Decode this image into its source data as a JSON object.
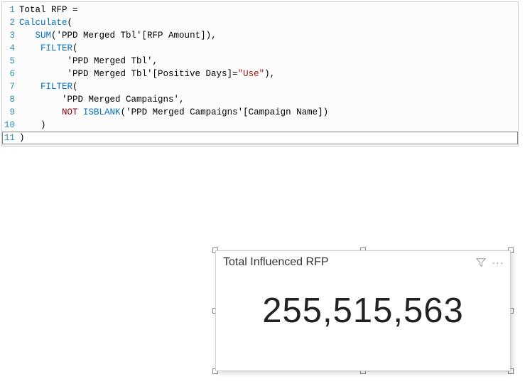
{
  "formula": {
    "lines": [
      {
        "num": "1",
        "indent": "",
        "tokens": [
          {
            "t": "plain",
            "v": "Total RFP = "
          }
        ]
      },
      {
        "num": "2",
        "indent": "",
        "tokens": [
          {
            "t": "kw-calc",
            "v": "Calculate"
          },
          {
            "t": "plain",
            "v": "("
          }
        ]
      },
      {
        "num": "3",
        "indent": "   ",
        "tokens": [
          {
            "t": "kw-fn",
            "v": "SUM"
          },
          {
            "t": "plain",
            "v": "('PPD Merged Tbl'[RFP Amount]),"
          }
        ]
      },
      {
        "num": "4",
        "indent": "    ",
        "tokens": [
          {
            "t": "kw-fn",
            "v": "FILTER"
          },
          {
            "t": "plain",
            "v": "("
          }
        ]
      },
      {
        "num": "5",
        "indent": "         ",
        "tokens": [
          {
            "t": "plain",
            "v": "'PPD Merged Tbl',"
          }
        ]
      },
      {
        "num": "6",
        "indent": "         ",
        "tokens": [
          {
            "t": "plain",
            "v": "'PPD Merged Tbl'[Positive Days]="
          },
          {
            "t": "string",
            "v": "\"Use\""
          },
          {
            "t": "plain",
            "v": "),"
          }
        ]
      },
      {
        "num": "7",
        "indent": "    ",
        "tokens": [
          {
            "t": "kw-fn",
            "v": "FILTER"
          },
          {
            "t": "plain",
            "v": "("
          }
        ]
      },
      {
        "num": "8",
        "indent": "        ",
        "tokens": [
          {
            "t": "plain",
            "v": "'PPD Merged Campaigns',"
          }
        ]
      },
      {
        "num": "9",
        "indent": "        ",
        "tokens": [
          {
            "t": "kw-not",
            "v": "NOT"
          },
          {
            "t": "plain",
            "v": " "
          },
          {
            "t": "kw-fn",
            "v": "ISBLANK"
          },
          {
            "t": "plain",
            "v": "('PPD Merged Campaigns'[Campaign Name])"
          }
        ]
      },
      {
        "num": "10",
        "indent": "    ",
        "tokens": [
          {
            "t": "plain",
            "v": ")"
          }
        ]
      },
      {
        "num": "11",
        "indent": "",
        "tokens": [
          {
            "t": "plain",
            "v": ")"
          }
        ]
      }
    ],
    "active_line": 11
  },
  "card": {
    "title": "Total Influenced RFP",
    "value": "255,515,563",
    "more_glyph": "···"
  }
}
